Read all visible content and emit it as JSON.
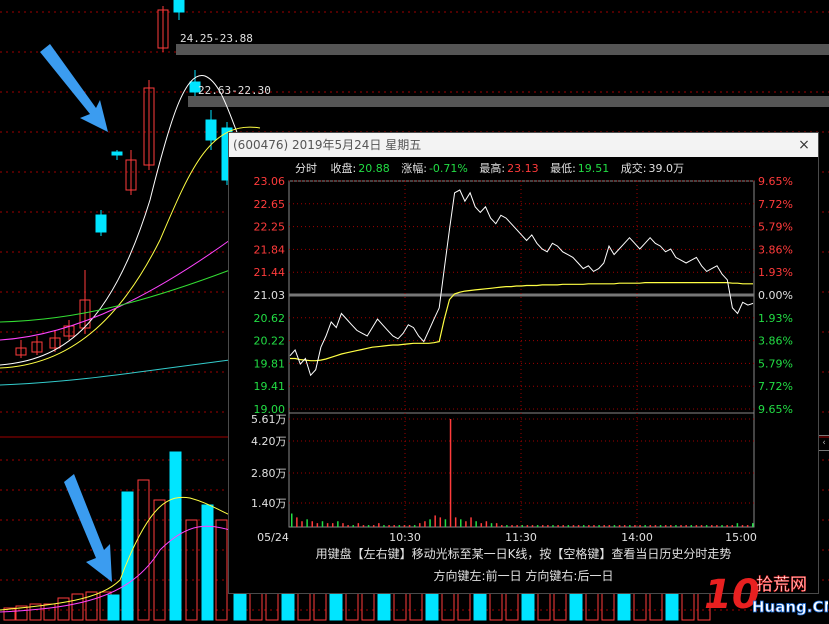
{
  "zones": [
    {
      "label": "24.25-23.88"
    },
    {
      "label": "22.63-22.30"
    }
  ],
  "popup": {
    "title": "(600476) 2019年5月24日 星期五",
    "close_glyph": "×",
    "info": {
      "tab": "分时",
      "close_label": "收盘:",
      "close_value": "20.88",
      "change_label": "涨幅:",
      "change_value": "-0.71%",
      "high_label": "最高:",
      "high_value": "23.13",
      "low_label": "最低:",
      "low_value": "19.51",
      "volume_label": "成交:",
      "volume_value": "39.0万"
    },
    "hint_line1": "用键盘【左右键】移动光标至某一日K线，按【空格键】查看当日历史分时走势",
    "hint_line2": "方向键左:前一日   方向键右:后一日"
  },
  "watermark": {
    "number": "10",
    "site_cn": "拾荒网",
    "site_en": "Huang.CN"
  },
  "colors": {
    "up": "#ff3b3b",
    "down": "#22dd44",
    "cyan": "#00e5ff",
    "yellow": "#ffff44",
    "grid": "#a00000"
  },
  "chart_data": {
    "type": "line",
    "price_axis_left": [
      "23.06",
      "22.65",
      "22.25",
      "21.84",
      "21.44",
      "21.03",
      "20.62",
      "20.22",
      "19.81",
      "19.41",
      "19.00"
    ],
    "pct_axis_right": [
      "9.65%",
      "7.72%",
      "5.79%",
      "3.86%",
      "1.93%",
      "0.00%",
      "1.93%",
      "3.86%",
      "5.79%",
      "7.72%",
      "9.65%"
    ],
    "volume_axis": [
      "5.61万",
      "4.20万",
      "2.80万",
      "1.40万"
    ],
    "time_axis": [
      "05/24",
      "10:30",
      "11:30",
      "14:00",
      "15:00"
    ],
    "ylim": [
      19.0,
      23.06
    ],
    "prev_close": 21.03,
    "series": [
      {
        "values": [
          19.95,
          20.05,
          19.8,
          19.9,
          19.6,
          19.7,
          20.1,
          20.3,
          20.55,
          20.45,
          20.7,
          20.6,
          20.5,
          20.4,
          20.35,
          20.3,
          20.45,
          20.6,
          20.5,
          20.4,
          20.3,
          20.25,
          20.35,
          20.5,
          20.45,
          20.3,
          20.2,
          20.4,
          20.6,
          20.8,
          21.5,
          22.2,
          22.85,
          22.9,
          22.7,
          22.85,
          22.6,
          22.5,
          22.6,
          22.4,
          22.3,
          22.45,
          22.4,
          22.3,
          22.2,
          22.1,
          22.0,
          22.1,
          21.95,
          21.85,
          21.8,
          21.95,
          21.9,
          21.8,
          21.75,
          21.7,
          21.6,
          21.5,
          21.55,
          21.45,
          21.5,
          21.6,
          21.9,
          21.75,
          21.85,
          21.95,
          22.05,
          21.95,
          21.85,
          21.95,
          22.05,
          21.95,
          21.9,
          21.8,
          21.85,
          21.7,
          21.65,
          21.6,
          21.65,
          21.7,
          21.55,
          21.45,
          21.5,
          21.55,
          21.4,
          21.3,
          20.8,
          20.7,
          20.9,
          20.85,
          20.88
        ]
      },
      {
        "values": [
          19.9,
          19.9,
          19.88,
          19.87,
          19.86,
          19.86,
          19.87,
          19.89,
          19.92,
          19.95,
          19.98,
          20.0,
          20.02,
          20.04,
          20.06,
          20.08,
          20.1,
          20.11,
          20.12,
          20.13,
          20.14,
          20.14,
          20.15,
          20.16,
          20.17,
          20.17,
          20.17,
          20.17,
          20.18,
          20.2,
          20.6,
          20.95,
          21.05,
          21.08,
          21.1,
          21.11,
          21.12,
          21.13,
          21.14,
          21.15,
          21.16,
          21.17,
          21.18,
          21.18,
          21.19,
          21.19,
          21.2,
          21.2,
          21.2,
          21.21,
          21.21,
          21.21,
          21.21,
          21.22,
          21.22,
          21.22,
          21.22,
          21.22,
          21.23,
          21.23,
          21.23,
          21.23,
          21.23,
          21.23,
          21.24,
          21.24,
          21.24,
          21.24,
          21.24,
          21.25,
          21.25,
          21.25,
          21.25,
          21.25,
          21.25,
          21.25,
          21.25,
          21.25,
          21.25,
          21.25,
          21.25,
          21.25,
          21.25,
          21.25,
          21.25,
          21.25,
          21.24,
          21.24,
          21.23,
          21.23,
          21.23
        ]
      }
    ],
    "volume": [
      0.7,
      0.5,
      0.3,
      0.4,
      0.3,
      0.2,
      0.3,
      0.2,
      0.2,
      0.3,
      0.2,
      0.1,
      0.1,
      0.2,
      0.1,
      0.1,
      0.1,
      0.2,
      0.1,
      0.1,
      0.1,
      0.1,
      0.1,
      0.1,
      0.1,
      0.2,
      0.3,
      0.4,
      0.6,
      0.5,
      0.4,
      5.61,
      0.5,
      0.4,
      0.3,
      0.5,
      0.3,
      0.2,
      0.3,
      0.2,
      0.2,
      0.1,
      0.1,
      0.1,
      0.1,
      0.1,
      0.1,
      0.1,
      0.1,
      0.1,
      0.1,
      0.1,
      0.1,
      0.1,
      0.1,
      0.1,
      0.1,
      0.1,
      0.1,
      0.1,
      0.1,
      0.1,
      0.1,
      0.1,
      0.1,
      0.1,
      0.1,
      0.1,
      0.1,
      0.1,
      0.1,
      0.1,
      0.1,
      0.1,
      0.1,
      0.1,
      0.1,
      0.1,
      0.1,
      0.1,
      0.1,
      0.1,
      0.1,
      0.1,
      0.1,
      0.1,
      0.1,
      0.2,
      0.1,
      0.1,
      0.2
    ]
  }
}
